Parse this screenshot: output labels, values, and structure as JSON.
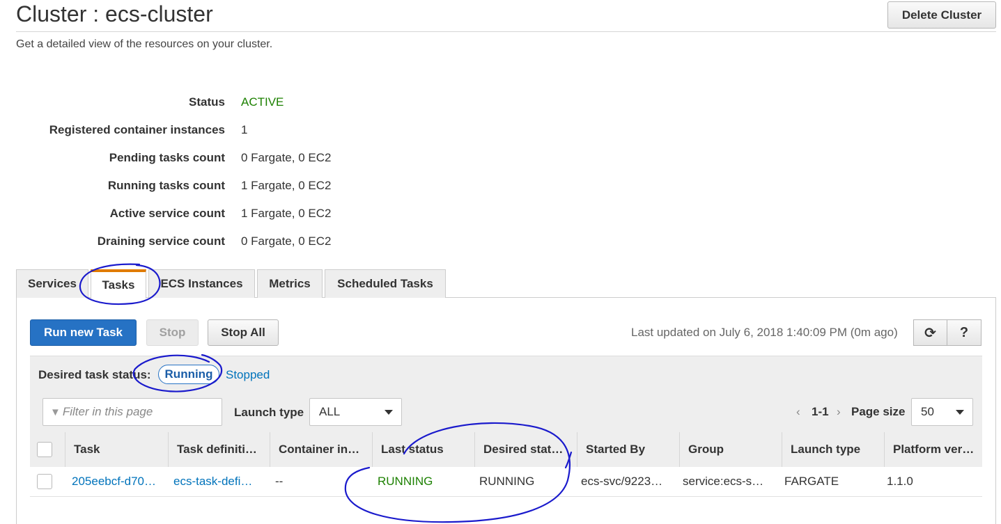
{
  "header": {
    "title": "Cluster : ecs-cluster",
    "delete_button": "Delete Cluster",
    "subtitle": "Get a detailed view of the resources on your cluster."
  },
  "details": [
    {
      "label": "Status",
      "value": "ACTIVE"
    },
    {
      "label": "Registered container instances",
      "value": "1"
    },
    {
      "label": "Pending tasks count",
      "value": "0 Fargate, 0 EC2"
    },
    {
      "label": "Running tasks count",
      "value": "1 Fargate, 0 EC2"
    },
    {
      "label": "Active service count",
      "value": "1 Fargate, 0 EC2"
    },
    {
      "label": "Draining service count",
      "value": "0 Fargate, 0 EC2"
    }
  ],
  "tabs": [
    {
      "label": "Services",
      "active": false
    },
    {
      "label": "Tasks",
      "active": true
    },
    {
      "label": "ECS Instances",
      "active": false
    },
    {
      "label": "Metrics",
      "active": false
    },
    {
      "label": "Scheduled Tasks",
      "active": false
    }
  ],
  "toolbar": {
    "run_new_task": "Run new Task",
    "stop": "Stop",
    "stop_all": "Stop All",
    "last_updated": "Last updated on July 6, 2018 1:40:09 PM (0m ago)",
    "refresh_icon": "refresh-icon",
    "help_icon": "help-icon",
    "refresh_glyph": "⟳",
    "help_glyph": "?"
  },
  "desired_status": {
    "label": "Desired task status:",
    "running": "Running",
    "stopped": "Stopped"
  },
  "filters": {
    "filter_placeholder": "Filter in this page",
    "launch_type_label": "Launch type",
    "launch_type_value": "ALL",
    "pager_prev": "‹",
    "pager_range": "1-1",
    "pager_next": "›",
    "page_size_label": "Page size",
    "page_size_value": "50"
  },
  "table": {
    "columns": [
      "Task",
      "Task definiti…",
      "Container in…",
      "Last status",
      "Desired stat…",
      "Started By",
      "Group",
      "Launch type",
      "Platform ver…"
    ],
    "rows": [
      [
        "205eebcf-d70…",
        "ecs-task-defi…",
        "--",
        "RUNNING",
        "RUNNING",
        "ecs-svc/9223…",
        "service:ecs-s…",
        "FARGATE",
        "1.1.0"
      ]
    ]
  },
  "colors": {
    "active_green": "#1d8102",
    "link_blue": "#0073bb",
    "primary_blue": "#2672c4",
    "tab_accent": "#e07b00",
    "annotation_ink": "#1a1acc"
  }
}
